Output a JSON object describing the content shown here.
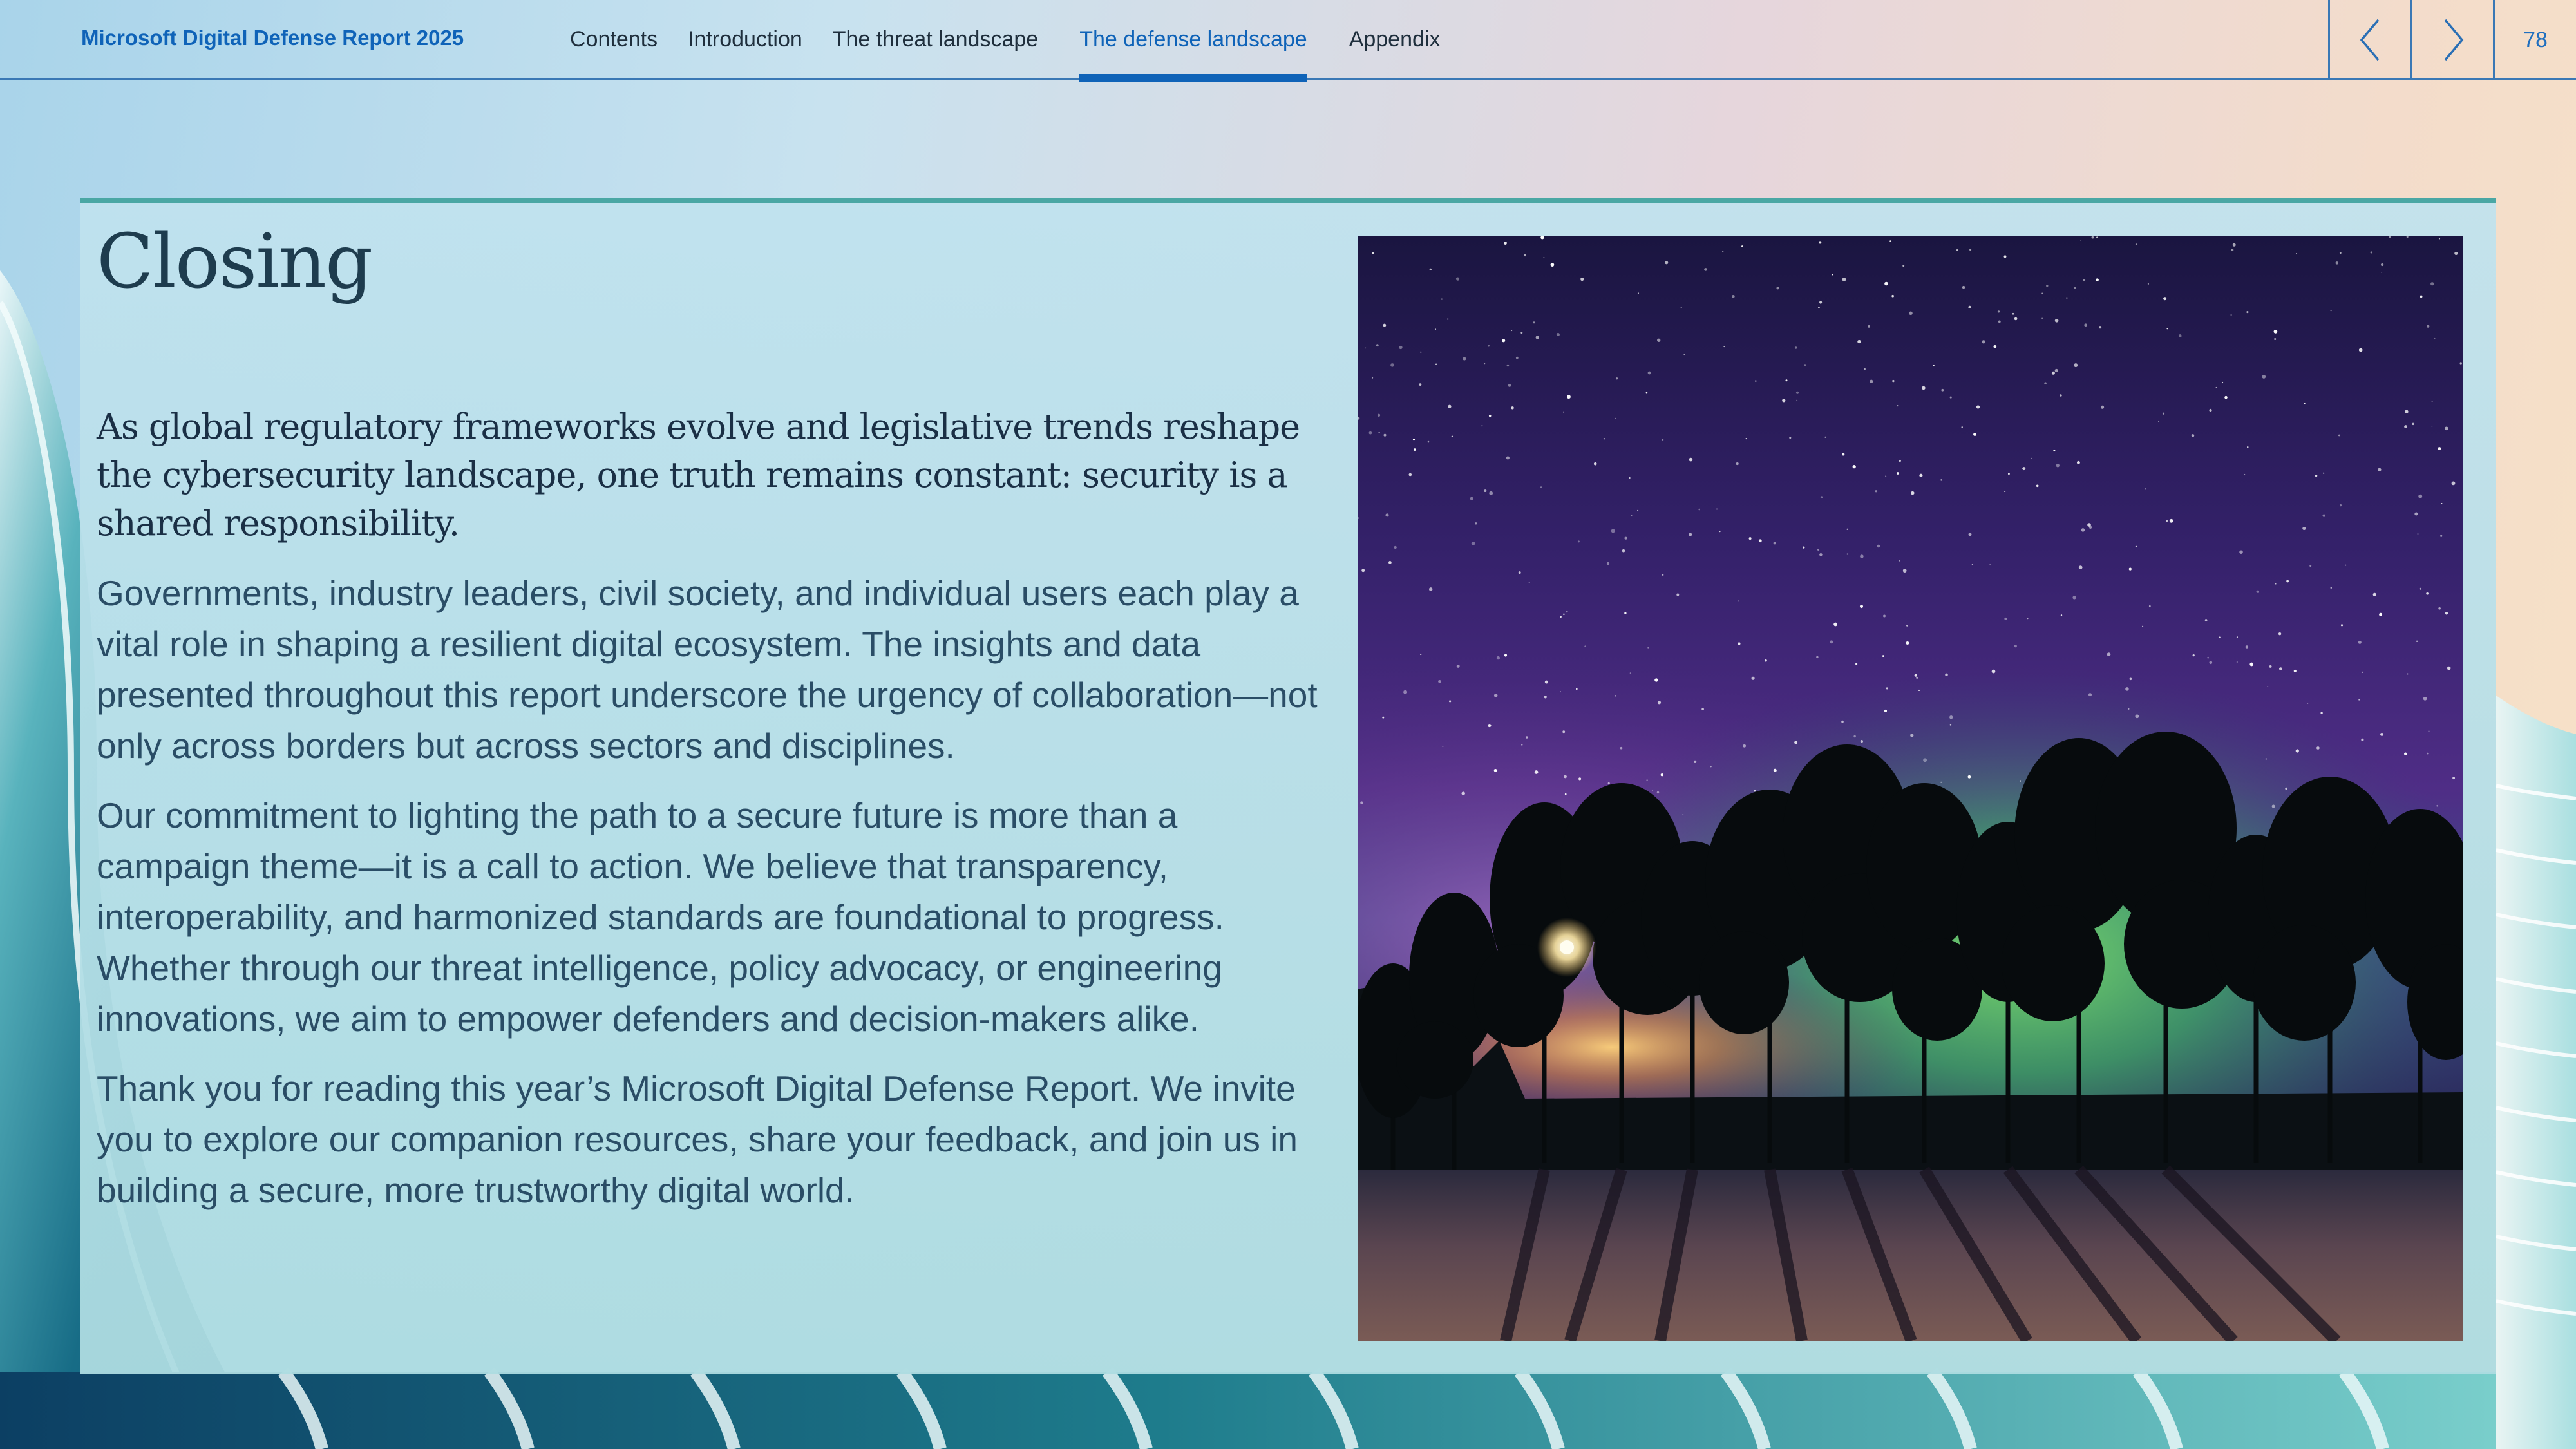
{
  "header": {
    "report_title": "Microsoft Digital Defense Report 2025",
    "nav": [
      {
        "label": "Contents",
        "active": false
      },
      {
        "label": "Introduction",
        "active": false
      },
      {
        "label": "The threat landscape",
        "active": false
      },
      {
        "label": "The defense landscape",
        "active": true
      },
      {
        "label": "Appendix",
        "active": false
      }
    ],
    "prev_icon": "chevron-left-icon",
    "next_icon": "chevron-right-icon",
    "page_number": "78"
  },
  "main": {
    "heading": "Closing",
    "lead": "As global regulatory frameworks evolve and legislative trends reshape the cybersecurity landscape, one truth remains constant: security is a shared responsibility.",
    "paragraphs": [
      "Governments, industry leaders, civil society, and individual users each play a vital role in shaping a resilient digital ecosystem. The insights and data presented throughout this report underscore the urgency of collaboration—not only across borders but across sectors and disciplines.",
      "Our commitment to lighting the path to a secure future is more than a campaign theme—it is a call to action. We believe that transparency, interoperability, and harmonized standards are foundational to progress. Whether through our threat intelligence, policy advocacy, or engineering innovations, we aim to empower defenders and decision-makers alike.",
      "Thank you for reading this year’s Microsoft Digital Defense Report. We invite you to explore our companion resources, share your feedback, and join us in building a secure, more trustworthy digital world."
    ]
  },
  "colors": {
    "accent": "#0f63b8",
    "card_border": "#4aa7a4",
    "heading": "#1e3c4e",
    "body_text": "#2a4d66"
  }
}
